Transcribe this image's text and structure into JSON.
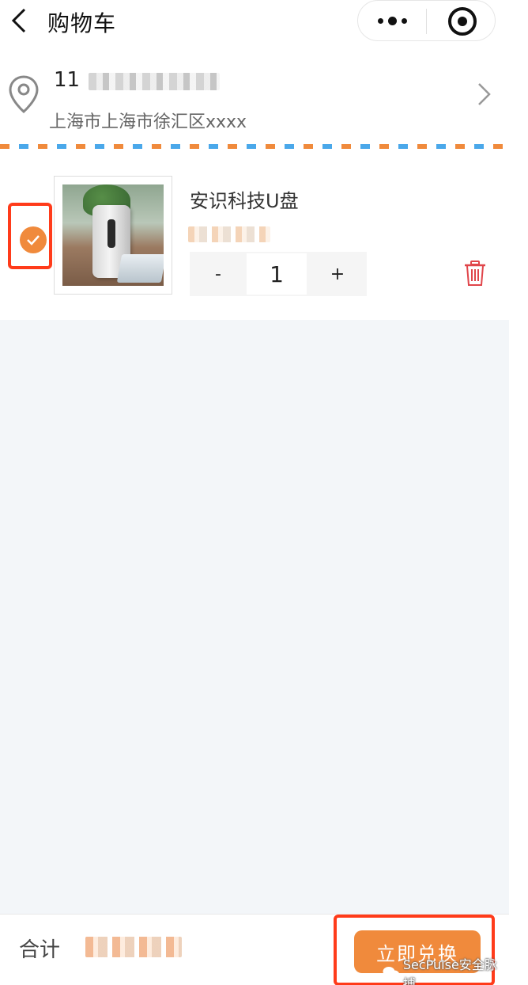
{
  "header": {
    "title": "购物车",
    "back_icon": "chevron-left-icon",
    "capsule": {
      "more_icon": "more-dots-icon",
      "target_icon": "target-icon"
    }
  },
  "address": {
    "name": "11",
    "detail": "上海市上海市徐汇区xxxx",
    "location_icon": "map-pin-icon",
    "arrow_icon": "chevron-right-icon"
  },
  "cart": {
    "items": [
      {
        "checked": true,
        "name": "安识科技U盘",
        "quantity": "1",
        "minus_label": "-",
        "plus_label": "+"
      }
    ]
  },
  "footer": {
    "total_label": "合计",
    "redeem_label": "立即兑换",
    "watermark": "SecPulse安全脉搏"
  },
  "colors": {
    "accent": "#f08a3c",
    "highlight_border": "#ff3b1a",
    "trash": "#e0454a",
    "stripe_blue": "#4aa8ea",
    "background": "#f3f6f9"
  }
}
